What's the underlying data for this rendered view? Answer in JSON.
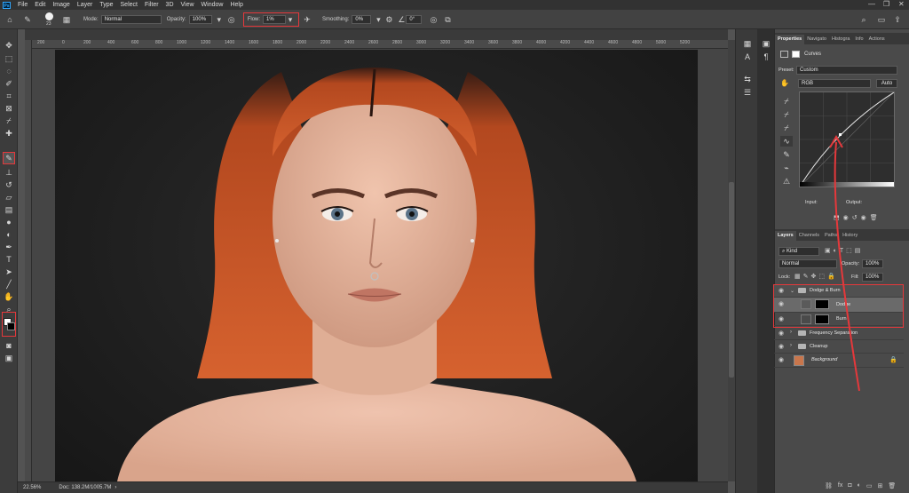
{
  "app": {
    "menu": [
      "File",
      "Edit",
      "Image",
      "Layer",
      "Type",
      "Select",
      "Filter",
      "3D",
      "View",
      "Window",
      "Help"
    ],
    "logo_text": "Ps"
  },
  "options_bar": {
    "brush_size": "23",
    "mode_label": "Mode:",
    "mode_value": "Normal",
    "opacity_label": "Opacity:",
    "opacity_value": "100%",
    "flow_label": "Flow:",
    "flow_value": "1%",
    "smoothing_label": "Smoothing:",
    "smoothing_value": "0%",
    "angle_value": "0°"
  },
  "ruler": {
    "ticks": [
      "200",
      "0",
      "200",
      "400",
      "600",
      "800",
      "1000",
      "1200",
      "1400",
      "1600",
      "1800",
      "2000",
      "2200",
      "2400",
      "2600",
      "2800",
      "3000",
      "3200",
      "3400",
      "3600",
      "3800",
      "4000",
      "4200",
      "4400",
      "4600",
      "4800",
      "5000",
      "5200"
    ]
  },
  "status": {
    "zoom": "22.56%",
    "doc": "Doc: 138.2M/1005.7M"
  },
  "properties_panel": {
    "tabs": [
      "Properties",
      "Navigato",
      "Histogra",
      "Info",
      "Actions"
    ],
    "adjustment_title": "Curves",
    "preset_label": "Preset:",
    "preset_value": "Custom",
    "channel_value": "RGB",
    "auto_label": "Auto",
    "input_label": "Input:",
    "output_label": "Output:"
  },
  "layers_panel": {
    "tabs": [
      "Layers",
      "Channels",
      "Paths",
      "History"
    ],
    "filter_kind": "Kind",
    "blend_mode": "Normal",
    "opacity_label": "Opacity:",
    "opacity_value": "100%",
    "lock_label": "Lock:",
    "fill_label": "Fill:",
    "fill_value": "100%",
    "layers": [
      {
        "name": "Dodge & Burn",
        "type": "group"
      },
      {
        "name": "Dodge",
        "type": "curves-adjustment"
      },
      {
        "name": "Burn",
        "type": "curves-adjustment"
      },
      {
        "name": "Frequency Separation",
        "type": "group"
      },
      {
        "name": "Cleanup",
        "type": "group"
      },
      {
        "name": "Background",
        "type": "image"
      }
    ]
  },
  "colors": {
    "highlight": "#e5383b",
    "hair": "#c5552d",
    "skin": "#e5b39c"
  }
}
